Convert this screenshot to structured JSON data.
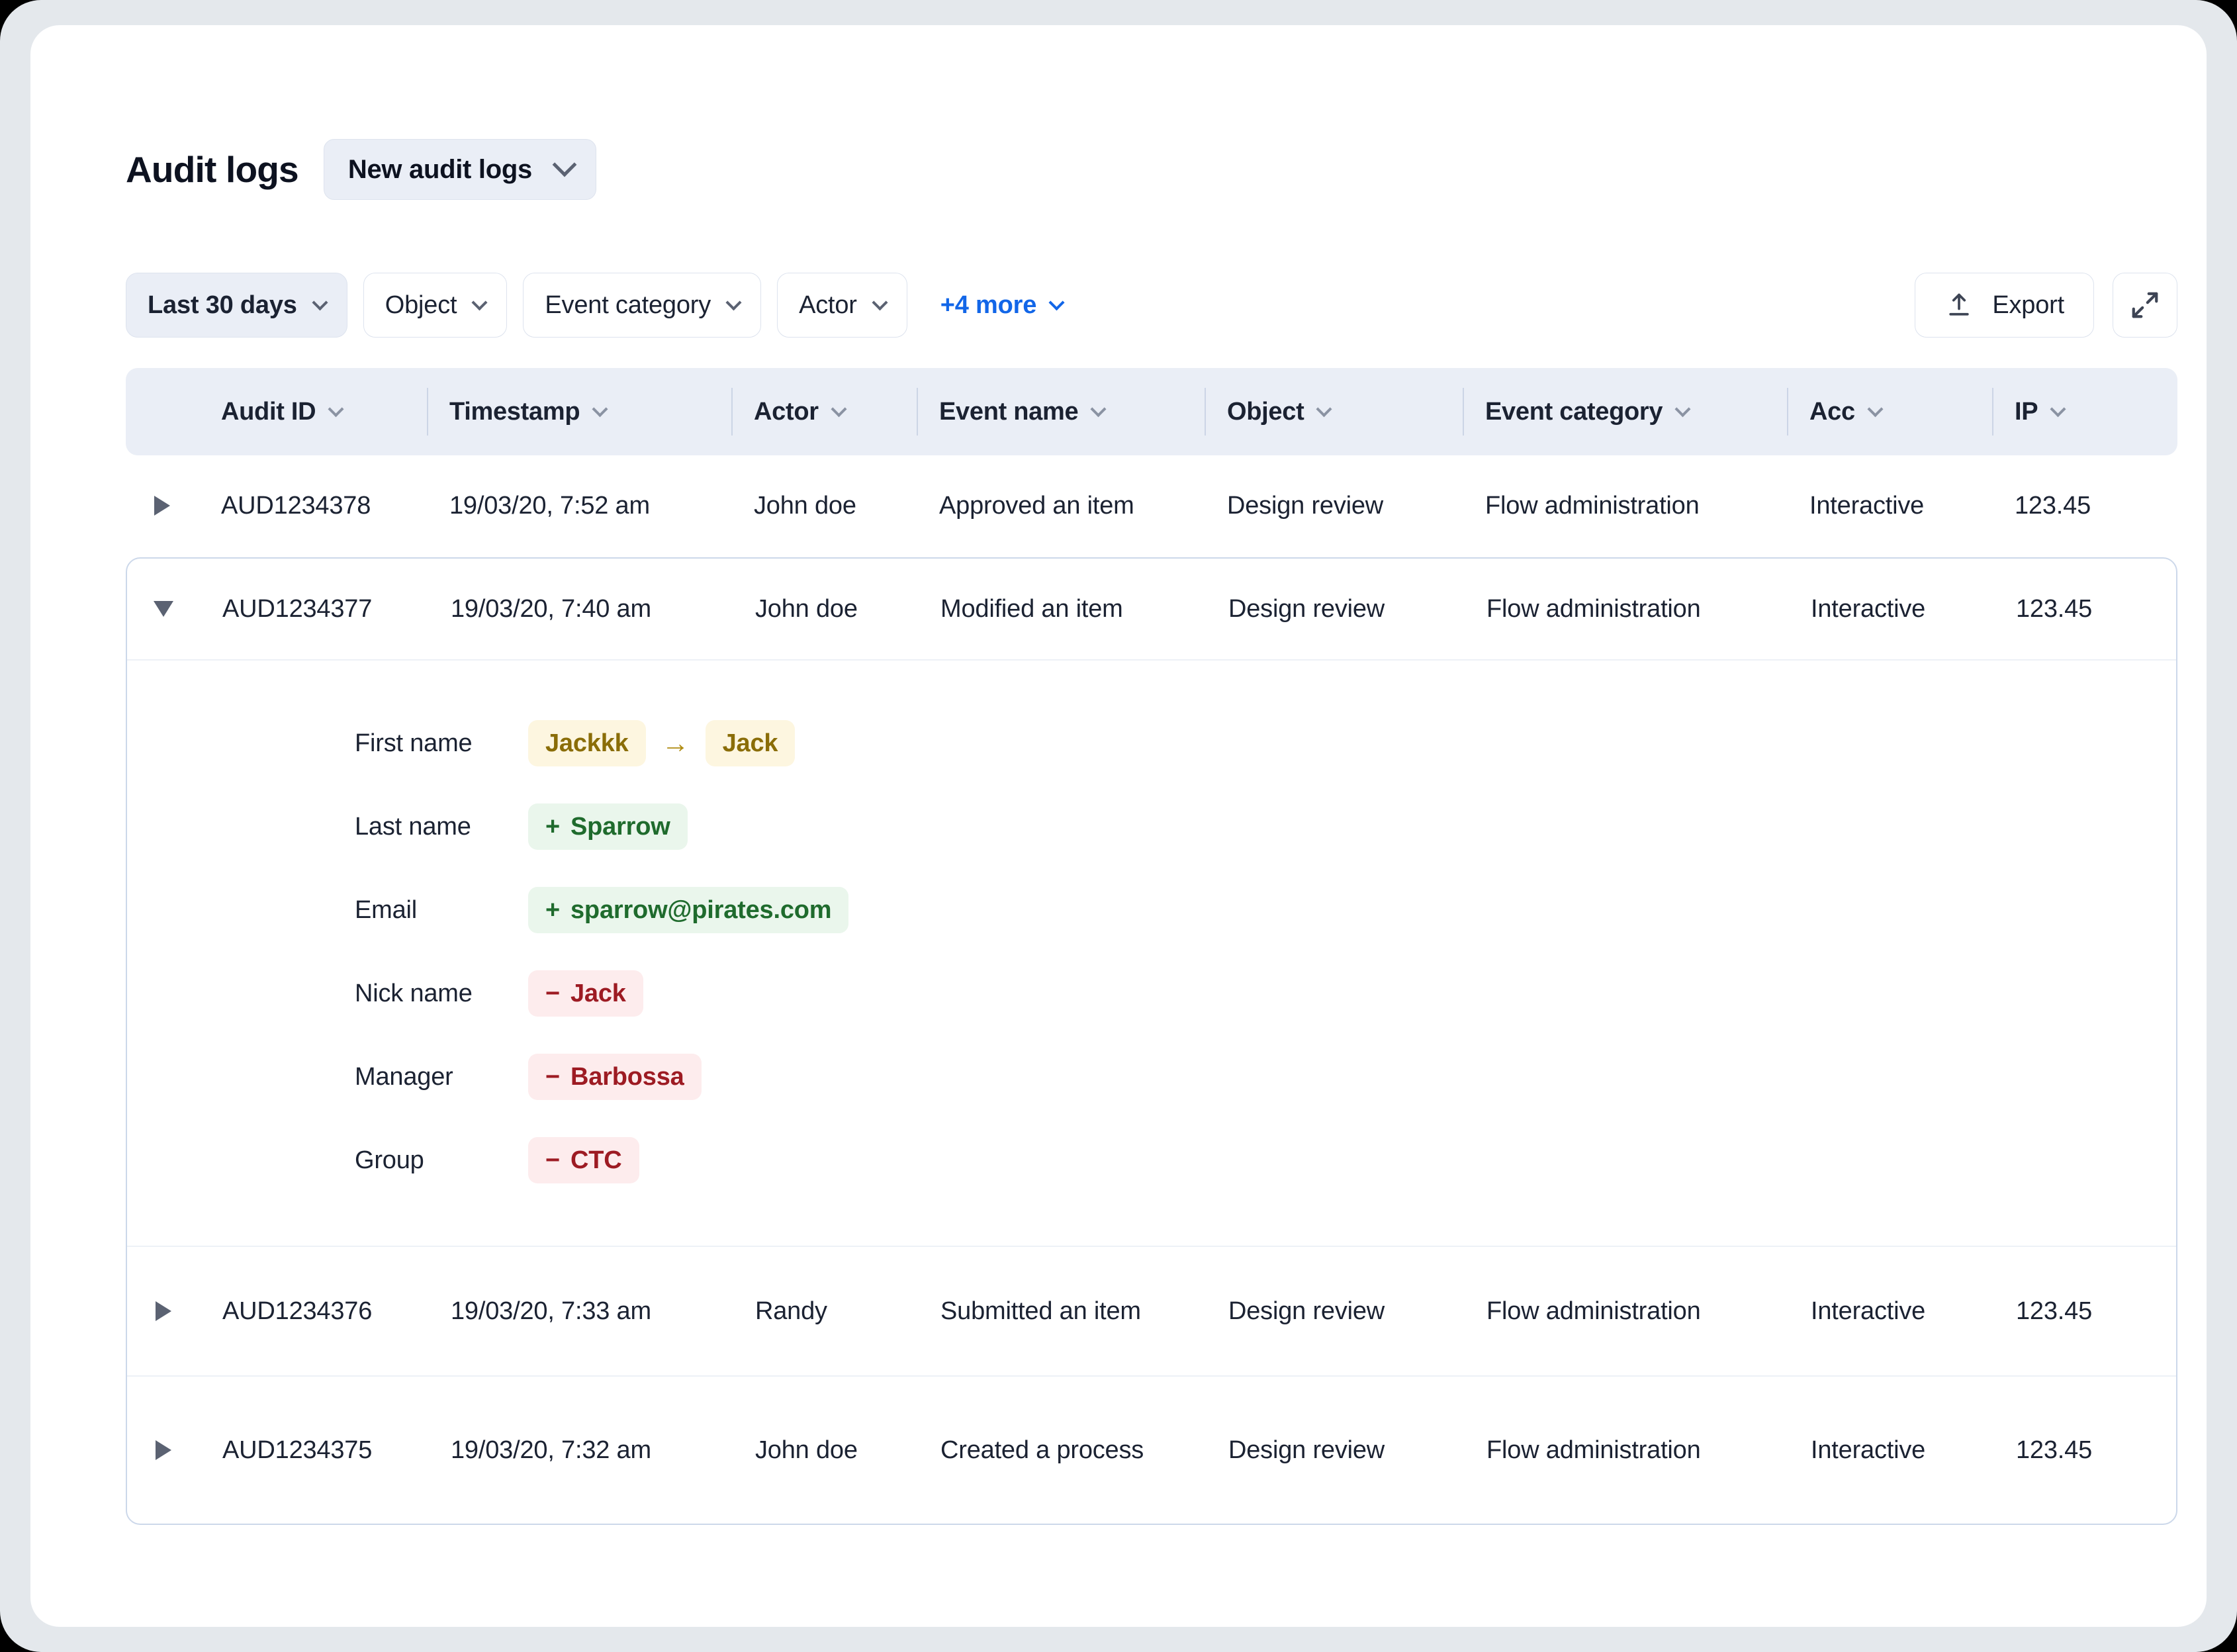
{
  "header": {
    "title": "Audit logs",
    "view_selector": {
      "label": "New audit logs",
      "icon": "chevron-down-icon"
    }
  },
  "filters": {
    "chips": [
      {
        "label": "Last 30 days",
        "active": true
      },
      {
        "label": "Object",
        "active": false
      },
      {
        "label": "Event category",
        "active": false
      },
      {
        "label": "Actor",
        "active": false
      }
    ],
    "more_label": "+4 more",
    "export_label": "Export",
    "export_icon": "upload-icon",
    "expand_icon": "expand-diagonal-icon"
  },
  "table": {
    "columns": [
      {
        "label": "Audit ID"
      },
      {
        "label": "Timestamp"
      },
      {
        "label": "Actor"
      },
      {
        "label": "Event name"
      },
      {
        "label": "Object"
      },
      {
        "label": "Event category"
      },
      {
        "label": "Acc"
      },
      {
        "label": "IP"
      }
    ],
    "rows": [
      {
        "audit_id": "AUD1234378",
        "timestamp": "19/03/20, 7:52 am",
        "actor": "John doe",
        "event_name": "Approved an item",
        "object": "Design review",
        "event_category": "Flow administration",
        "acc": "Interactive",
        "ip": "123.45",
        "expanded": false
      },
      {
        "audit_id": "AUD1234377",
        "timestamp": "19/03/20, 7:40 am",
        "actor": "John doe",
        "event_name": "Modified an item",
        "object": "Design review",
        "event_category": "Flow administration",
        "acc": "Interactive",
        "ip": "123.45",
        "expanded": true
      },
      {
        "audit_id": "AUD1234376",
        "timestamp": "19/03/20, 7:33 am",
        "actor": "Randy",
        "event_name": "Submitted an item",
        "object": "Design review",
        "event_category": "Flow administration",
        "acc": "Interactive",
        "ip": "123.45",
        "expanded": false
      },
      {
        "audit_id": "AUD1234375",
        "timestamp": "19/03/20, 7:32 am",
        "actor": "John doe",
        "event_name": "Created a process",
        "object": "Design review",
        "event_category": "Flow administration",
        "acc": "Interactive",
        "ip": "123.45",
        "expanded": false
      }
    ]
  },
  "detail": {
    "changes": [
      {
        "field": "First name",
        "type": "changed",
        "from": "Jackkk",
        "to": "Jack",
        "arrow": "→"
      },
      {
        "field": "Last name",
        "type": "added",
        "sign": "+",
        "value": "Sparrow"
      },
      {
        "field": "Email",
        "type": "added",
        "sign": "+",
        "value": "sparrow@pirates.com"
      },
      {
        "field": "Nick name",
        "type": "removed",
        "sign": "−",
        "value": "Jack"
      },
      {
        "field": "Manager",
        "type": "removed",
        "sign": "−",
        "value": "Barbossa"
      },
      {
        "field": "Group",
        "type": "removed",
        "sign": "−",
        "value": "CTC"
      }
    ]
  },
  "colors": {
    "link": "#1266e8",
    "header_bg": "#eaeef6",
    "added": "#1f6b2d",
    "removed": "#9d1b23",
    "changed": "#8a6d08",
    "page_bg": "#e4e8ec"
  }
}
